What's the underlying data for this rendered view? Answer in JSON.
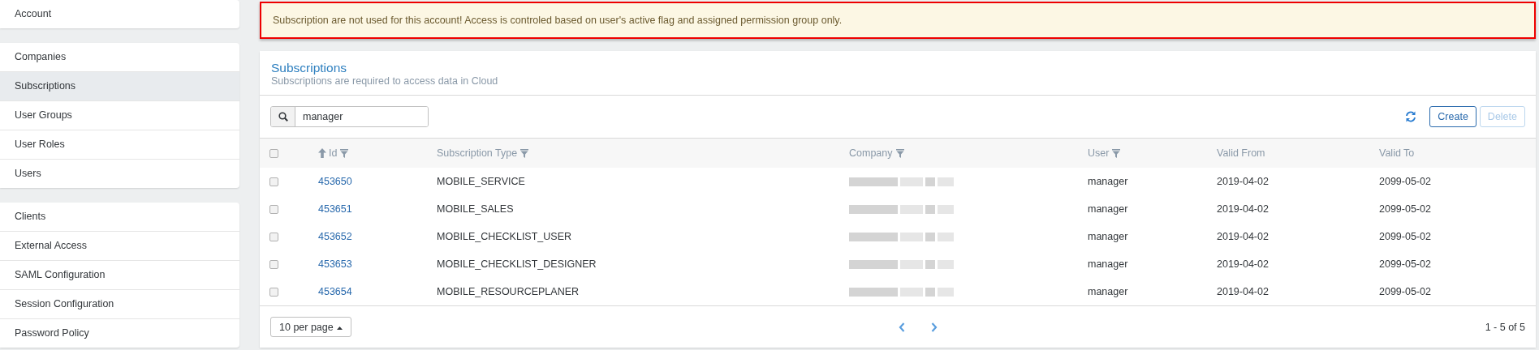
{
  "sidebar": {
    "groups": [
      [
        {
          "label": "Account",
          "selected": false
        }
      ],
      [
        {
          "label": "Companies",
          "selected": false
        },
        {
          "label": "Subscriptions",
          "selected": true
        },
        {
          "label": "User Groups",
          "selected": false
        },
        {
          "label": "User Roles",
          "selected": false
        },
        {
          "label": "Users",
          "selected": false
        }
      ],
      [
        {
          "label": "Clients",
          "selected": false
        },
        {
          "label": "External Access",
          "selected": false
        },
        {
          "label": "SAML Configuration",
          "selected": false
        },
        {
          "label": "Session Configuration",
          "selected": false
        },
        {
          "label": "Password Policy",
          "selected": false
        }
      ]
    ]
  },
  "notice": {
    "text": "Subscription are not used for this account! Access is controled based on user's active flag and assigned permission group only."
  },
  "card": {
    "title": "Subscriptions",
    "subtitle": "Subscriptions are required to access data in Cloud",
    "search": {
      "value": "manager"
    },
    "buttons": [
      {
        "label": "Create",
        "disabled": false
      },
      {
        "label": "Delete",
        "disabled": true
      }
    ],
    "table": {
      "select_all": {
        "checked": false
      },
      "columns": [
        {
          "label": "Id",
          "sorted": true,
          "filter": true
        },
        {
          "label": "Subscription Type",
          "sorted": false,
          "filter": true
        },
        {
          "label": "Company",
          "sorted": false,
          "filter": true
        },
        {
          "label": "User",
          "sorted": false,
          "filter": true
        },
        {
          "label": "Valid From",
          "sorted": false,
          "filter": false
        },
        {
          "label": "Valid To",
          "sorted": false,
          "filter": false
        }
      ],
      "rows": [
        {
          "checked": false,
          "id": "453650",
          "type": "MOBILE_SERVICE",
          "company": {
            "kind": "redacted"
          },
          "user": "manager",
          "valid_from": "2019-04-02",
          "valid_to": "2099-05-02"
        },
        {
          "checked": false,
          "id": "453651",
          "type": "MOBILE_SALES",
          "company": {
            "kind": "redacted"
          },
          "user": "manager",
          "valid_from": "2019-04-02",
          "valid_to": "2099-05-02"
        },
        {
          "checked": false,
          "id": "453652",
          "type": "MOBILE_CHECKLIST_USER",
          "company": {
            "kind": "redacted"
          },
          "user": "manager",
          "valid_from": "2019-04-02",
          "valid_to": "2099-05-02"
        },
        {
          "checked": false,
          "id": "453653",
          "type": "MOBILE_CHECKLIST_DESIGNER",
          "company": {
            "kind": "redacted"
          },
          "user": "manager",
          "valid_from": "2019-04-02",
          "valid_to": "2099-05-02"
        },
        {
          "checked": false,
          "id": "453654",
          "type": "MOBILE_RESOURCEPLANER",
          "company": {
            "kind": "redacted"
          },
          "user": "manager",
          "valid_from": "2019-04-02",
          "valid_to": "2099-05-02"
        }
      ]
    },
    "footer": {
      "page_size": "10 per page",
      "range": "1 - 5 of 5"
    }
  }
}
